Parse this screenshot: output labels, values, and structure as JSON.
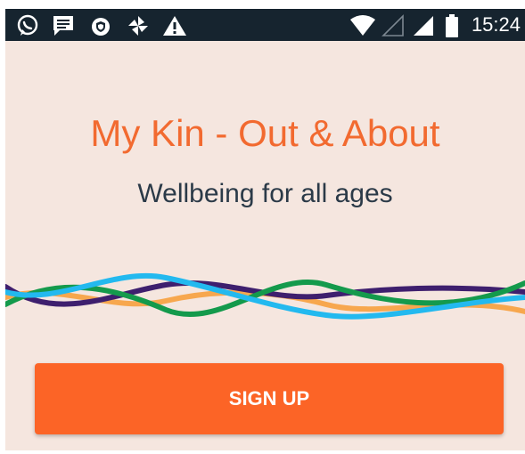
{
  "status_bar": {
    "left_icons": [
      "whatsapp-icon",
      "message-icon",
      "shield-icon",
      "pinwheel-icon",
      "warning-icon"
    ],
    "right_icons": [
      "wifi-icon",
      "signal-empty-icon",
      "signal-full-icon",
      "battery-icon"
    ],
    "time": "15:24"
  },
  "app": {
    "title": "My Kin - Out & About",
    "subtitle": "Wellbeing for all ages",
    "signup_label": "SIGN UP"
  },
  "colors": {
    "background": "#f5e6df",
    "status_bar": "#16242f",
    "title": "#f26a30",
    "subtitle": "#2b3a48",
    "button": "#fc6426",
    "wave_purple": "#3e1f6e",
    "wave_orange": "#f7a74e",
    "wave_green": "#149a4c",
    "wave_blue": "#23b9ef"
  }
}
